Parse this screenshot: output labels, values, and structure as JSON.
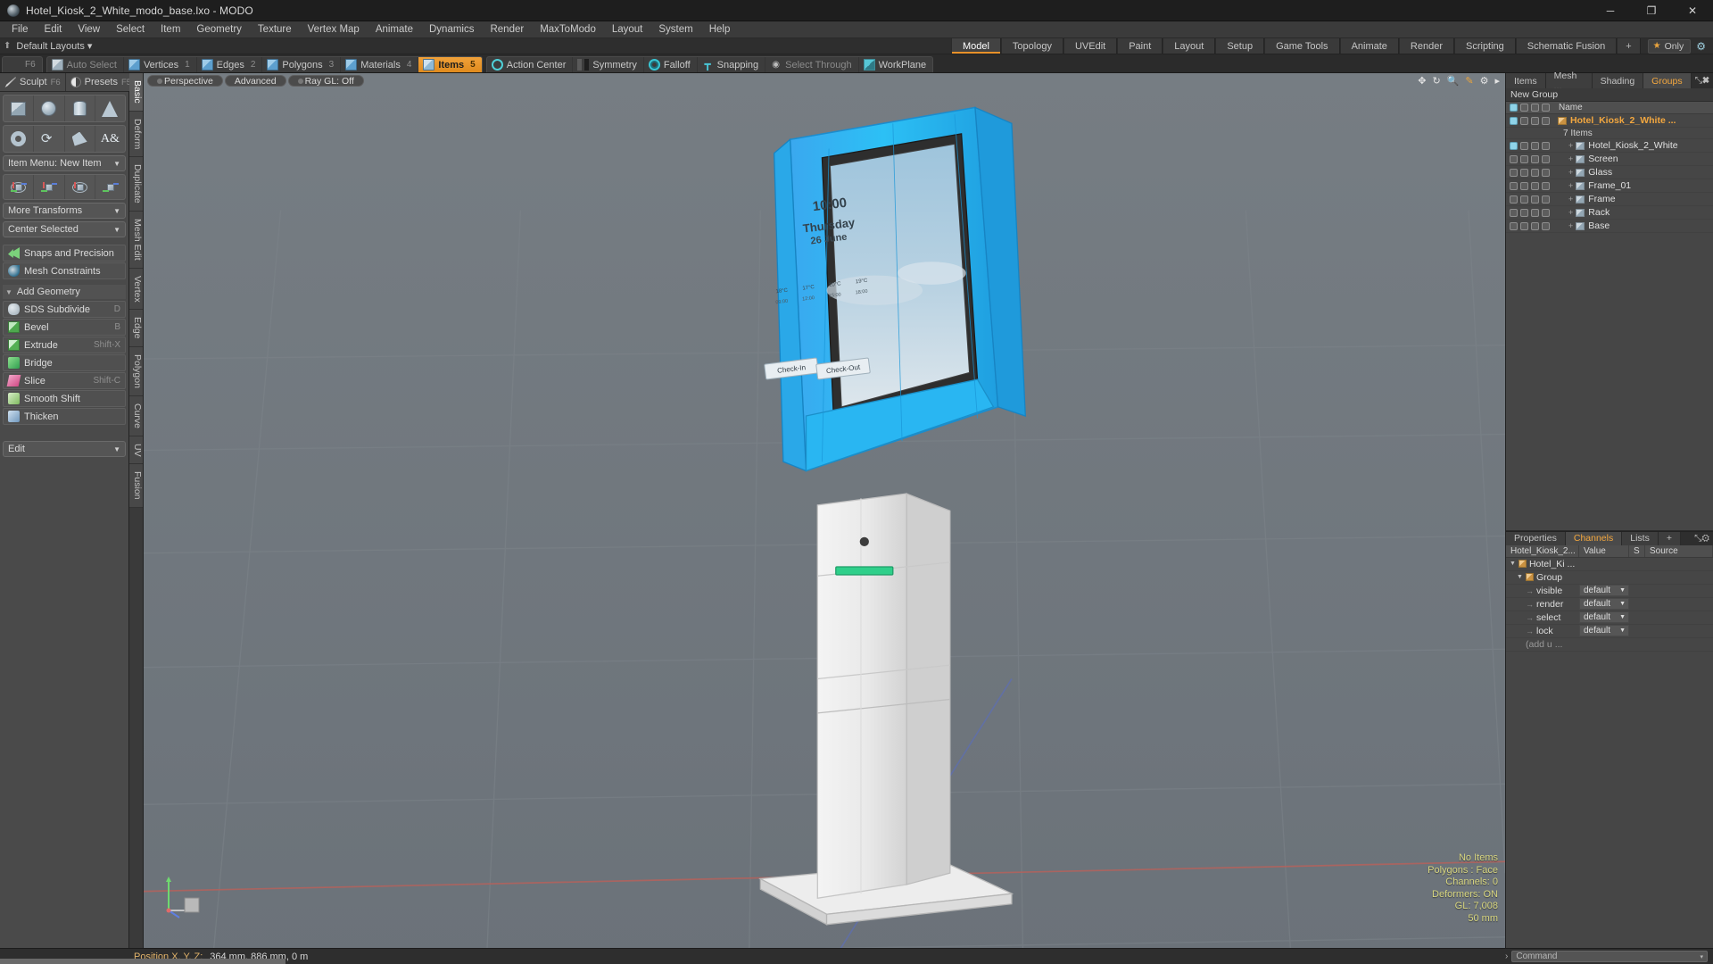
{
  "window": {
    "title": "Hotel_Kiosk_2_White_modo_base.lxo - MODO",
    "minimize": "─",
    "maximize": "❐",
    "close": "✕"
  },
  "menu": {
    "items": [
      "File",
      "Edit",
      "View",
      "Select",
      "Item",
      "Geometry",
      "Texture",
      "Vertex Map",
      "Animate",
      "Dynamics",
      "Render",
      "MaxToModo",
      "Layout",
      "System",
      "Help"
    ]
  },
  "layout_bar": {
    "layouts_label": "Default Layouts",
    "caret": "▾",
    "up_arrow": "⬆",
    "tabs": [
      {
        "label": "Model",
        "active": true
      },
      {
        "label": "Topology",
        "active": false
      },
      {
        "label": "UVEdit",
        "active": false
      },
      {
        "label": "Paint",
        "active": false
      },
      {
        "label": "Layout",
        "active": false
      },
      {
        "label": "Setup",
        "active": false
      },
      {
        "label": "Game Tools",
        "active": false
      },
      {
        "label": "Animate",
        "active": false
      },
      {
        "label": "Render",
        "active": false
      },
      {
        "label": "Scripting",
        "active": false
      },
      {
        "label": "Schematic Fusion",
        "active": false
      }
    ],
    "add_tab": "+",
    "only_label": "Only",
    "only_star": "★",
    "gear": "⚙"
  },
  "selection_toolbar": {
    "groups": [
      {
        "items": [
          {
            "label": "",
            "icon": "f6-key",
            "num": "F6",
            "dim": true,
            "kind": "handle"
          }
        ]
      },
      {
        "items": [
          {
            "label": "Auto Select",
            "icon": "cube-grey-icon",
            "num": "",
            "dim": true,
            "active": false
          },
          {
            "label": "Vertices",
            "icon": "cube-blue-icon",
            "num": "1",
            "dim": false,
            "active": false
          },
          {
            "label": "Edges",
            "icon": "cube-blue-icon",
            "num": "2",
            "dim": false,
            "active": false
          },
          {
            "label": "Polygons",
            "icon": "cube-blue-icon",
            "num": "3",
            "dim": false,
            "active": false
          },
          {
            "label": "Materials",
            "icon": "cube-blue-icon",
            "num": "4",
            "dim": false,
            "active": false
          },
          {
            "label": "Items",
            "icon": "cube-orange-icon",
            "num": "5",
            "dim": false,
            "active": true
          }
        ]
      },
      {
        "items": [
          {
            "label": "Action Center",
            "icon": "action-center-icon",
            "num": "",
            "dim": false,
            "active": false
          },
          {
            "label": "Symmetry",
            "icon": "symmetry-icon",
            "num": "",
            "dim": false,
            "active": false
          },
          {
            "label": "Falloff",
            "icon": "falloff-icon",
            "num": "",
            "dim": false,
            "active": false
          },
          {
            "label": "Snapping",
            "icon": "snapping-icon",
            "num": "",
            "dim": false,
            "active": false
          },
          {
            "label": "Select Through",
            "icon": "select-through-icon",
            "num": "",
            "dim": true,
            "active": false
          },
          {
            "label": "WorkPlane",
            "icon": "workplane-icon",
            "num": "",
            "dim": false,
            "active": false
          }
        ]
      }
    ]
  },
  "left_panel": {
    "tabs": [
      {
        "label": "Sculpt",
        "key": "F6",
        "icon": "sculpt-icon"
      },
      {
        "label": "Presets",
        "key": "F5",
        "icon": "presets-icon"
      }
    ],
    "primitives_row1": [
      {
        "name": "cube-primitive",
        "shape": "box"
      },
      {
        "name": "sphere-primitive",
        "shape": "sphere"
      },
      {
        "name": "cylinder-primitive",
        "shape": "cyl"
      },
      {
        "name": "cone-primitive",
        "shape": "cone"
      }
    ],
    "primitives_row2": [
      {
        "name": "torus-primitive",
        "shape": "torus"
      },
      {
        "name": "curve-primitive",
        "shape": "curve"
      },
      {
        "name": "polygon-primitive",
        "shape": "poly"
      },
      {
        "name": "text-primitive",
        "shape": "text"
      }
    ],
    "item_menu": "Item Menu: New Item",
    "transforms": [
      {
        "name": "move-gizmo"
      },
      {
        "name": "translate-gizmo"
      },
      {
        "name": "rotate-gizmo"
      },
      {
        "name": "scale-gizmo"
      }
    ],
    "more_transforms": "More Transforms",
    "center_selected": "Center Selected",
    "snaps": "Snaps and Precision",
    "mesh_constraints": "Mesh Constraints",
    "add_geometry_header": "Add Geometry",
    "geometry_items": [
      {
        "label": "SDS Subdivide",
        "key": "D",
        "icon": "sds"
      },
      {
        "label": "Bevel",
        "key": "B",
        "icon": "bevel"
      },
      {
        "label": "Extrude",
        "key": "Shift-X",
        "icon": "extr"
      },
      {
        "label": "Bridge",
        "key": "",
        "icon": "bridge"
      },
      {
        "label": "Slice",
        "key": "Shift-C",
        "icon": "slice"
      },
      {
        "label": "Smooth Shift",
        "key": "",
        "icon": "smsh"
      },
      {
        "label": "Thicken",
        "key": "",
        "icon": "thick"
      }
    ],
    "edit_dropdown": "Edit"
  },
  "vertical_tabs": [
    {
      "label": "Basic",
      "active": true
    },
    {
      "label": "Deform",
      "active": false
    },
    {
      "label": "Duplicate",
      "active": false
    },
    {
      "label": "Mesh Edit",
      "active": false
    },
    {
      "label": "Vertex",
      "active": false
    },
    {
      "label": "Edge",
      "active": false
    },
    {
      "label": "Polygon",
      "active": false
    },
    {
      "label": "Curve",
      "active": false
    },
    {
      "label": "UV",
      "active": false
    },
    {
      "label": "Fusion",
      "active": false
    }
  ],
  "viewport": {
    "chips": [
      {
        "label": "Perspective",
        "dot": true
      },
      {
        "label": "Advanced",
        "dot": false
      },
      {
        "label": "Ray GL: Off",
        "dot": true
      }
    ],
    "icons": [
      "move-view-icon",
      "rotate-view-icon",
      "zoom-view-icon",
      "pen-icon",
      "gear-icon",
      "chevron-right-icon"
    ],
    "kiosk_screen": {
      "time": "10:00",
      "day": "Thursday",
      "date": "26 June",
      "weather_temps": [
        "18°C",
        "17°C",
        "20°C",
        "19°C"
      ],
      "weather_sub": [
        "09:00",
        "12:00",
        "15:00",
        "18:00"
      ],
      "buttons": [
        "Check-In",
        "Check-Out"
      ]
    },
    "stats": [
      "No Items",
      "Polygons : Face",
      "Channels: 0",
      "Deformers: ON",
      "GL: 7,008",
      "50 mm"
    ]
  },
  "right_panel": {
    "tabs": [
      {
        "label": "Items",
        "active": false
      },
      {
        "label": "Mesh ...",
        "active": false
      },
      {
        "label": "Shading",
        "active": false
      },
      {
        "label": "Groups",
        "active": true
      }
    ],
    "new_group": "New Group",
    "list_header_name": "Name",
    "items": [
      {
        "label": "Hotel_Kiosk_2_White ...",
        "selected": true,
        "indent": 0,
        "icon": "group-icon",
        "expander": ""
      },
      {
        "label": "Hotel_Kiosk_2_White",
        "selected": false,
        "indent": 1,
        "icon": "mesh-icon",
        "expander": "+"
      },
      {
        "label": "Screen",
        "selected": false,
        "indent": 1,
        "icon": "mesh-icon",
        "expander": "+"
      },
      {
        "label": "Glass",
        "selected": false,
        "indent": 1,
        "icon": "mesh-icon",
        "expander": "+"
      },
      {
        "label": "Frame_01",
        "selected": false,
        "indent": 1,
        "icon": "mesh-icon",
        "expander": "+"
      },
      {
        "label": "Frame",
        "selected": false,
        "indent": 1,
        "icon": "mesh-icon",
        "expander": "+"
      },
      {
        "label": "Rack",
        "selected": false,
        "indent": 1,
        "icon": "mesh-icon",
        "expander": "+"
      },
      {
        "label": "Base",
        "selected": false,
        "indent": 1,
        "icon": "mesh-icon",
        "expander": "+"
      }
    ],
    "item_count": "7 Items"
  },
  "channels_panel": {
    "tabs": [
      {
        "label": "Properties",
        "active": false
      },
      {
        "label": "Channels",
        "active": true
      },
      {
        "label": "Lists",
        "active": false
      },
      {
        "label": "+",
        "active": false
      }
    ],
    "columns": [
      "Hotel_Kiosk_2...",
      "Value",
      "S",
      "Source"
    ],
    "rows": [
      {
        "name": "Hotel_Ki ...",
        "value": "",
        "tri": "▼",
        "type": "root"
      },
      {
        "name": "Group",
        "value": "",
        "tri": "▼",
        "type": "group"
      },
      {
        "name": "visible",
        "value": "default",
        "tri": "",
        "type": "chan"
      },
      {
        "name": "render",
        "value": "default",
        "tri": "",
        "type": "chan"
      },
      {
        "name": "select",
        "value": "default",
        "tri": "",
        "type": "chan"
      },
      {
        "name": "lock",
        "value": "default",
        "tri": "",
        "type": "chan"
      },
      {
        "name": "(add u ...",
        "value": "",
        "tri": "",
        "type": "add"
      }
    ]
  },
  "status_bar": {
    "position_label": "Position X, Y, Z:",
    "position_value": "364 mm, 886 mm, 0 m",
    "command_placeholder": "Command",
    "command_arrow": "›",
    "command_caret": "▾"
  },
  "colors": {
    "accent_orange": "#e8912a",
    "selection_blue": "#2fb8f0",
    "panel_bg": "#3b3b3b",
    "viewport_bg": "#6e757b",
    "status_yellow": "#d8d680"
  }
}
